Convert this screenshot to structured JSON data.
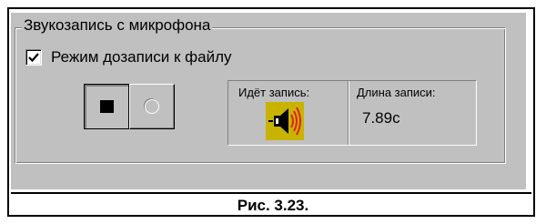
{
  "dialog": {
    "group_title": "Звукозапись с микрофона",
    "append_mode": {
      "label": "Режим дозаписи к файлу",
      "checked": true
    },
    "buttons": {
      "stop_icon": "stop-square-icon",
      "record_icon": "record-circle-icon"
    },
    "status": {
      "recording_label": "Идёт запись:",
      "recording_icon": "speaker-icon",
      "length_label": "Длина записи:",
      "length_value": "7.89c"
    }
  },
  "figure": {
    "caption": "Рис. 3.23."
  },
  "colors": {
    "face": "#c0c0c0",
    "shadow": "#808080",
    "highlight": "#ffffff",
    "icon_background": "#c8b400",
    "icon_waves": "#e02020"
  }
}
